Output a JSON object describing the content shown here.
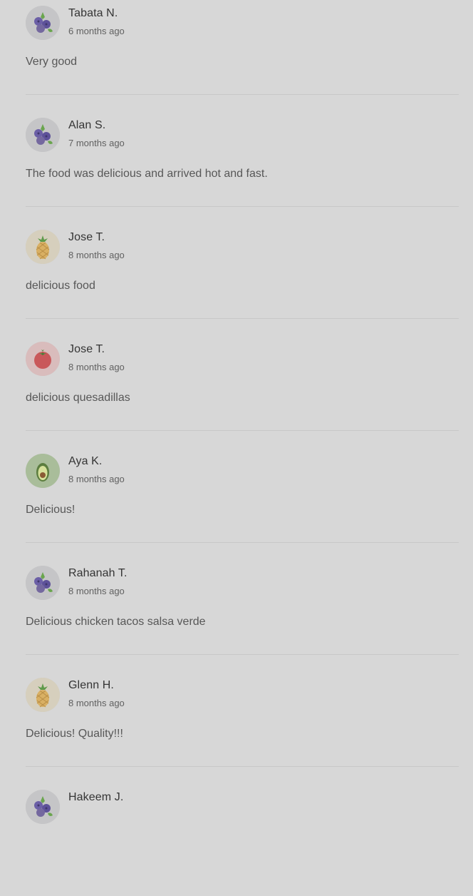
{
  "reviews": [
    {
      "name": "Tabata N.",
      "time": "6 months ago",
      "text": "Very good",
      "avatar": "blueberry-icon"
    },
    {
      "name": "Alan S.",
      "time": "7 months ago",
      "text": "The food was delicious and arrived hot and fast.",
      "avatar": "blueberry-icon"
    },
    {
      "name": "Jose T.",
      "time": "8 months ago",
      "text": "delicious food",
      "avatar": "pineapple-icon"
    },
    {
      "name": "Jose T.",
      "time": "8 months ago",
      "text": "delicious quesadillas",
      "avatar": "tomato-icon"
    },
    {
      "name": "Aya K.",
      "time": "8 months ago",
      "text": "Delicious!",
      "avatar": "avocado-icon"
    },
    {
      "name": "Rahanah T.",
      "time": "8 months ago",
      "text": "Delicious chicken tacos salsa verde",
      "avatar": "blueberry-icon"
    },
    {
      "name": "Glenn H.",
      "time": "8 months ago",
      "text": "Delicious! Quality!!!",
      "avatar": "pineapple-icon"
    },
    {
      "name": "Hakeem J.",
      "time": "",
      "text": "",
      "avatar": "blueberry-icon"
    }
  ]
}
